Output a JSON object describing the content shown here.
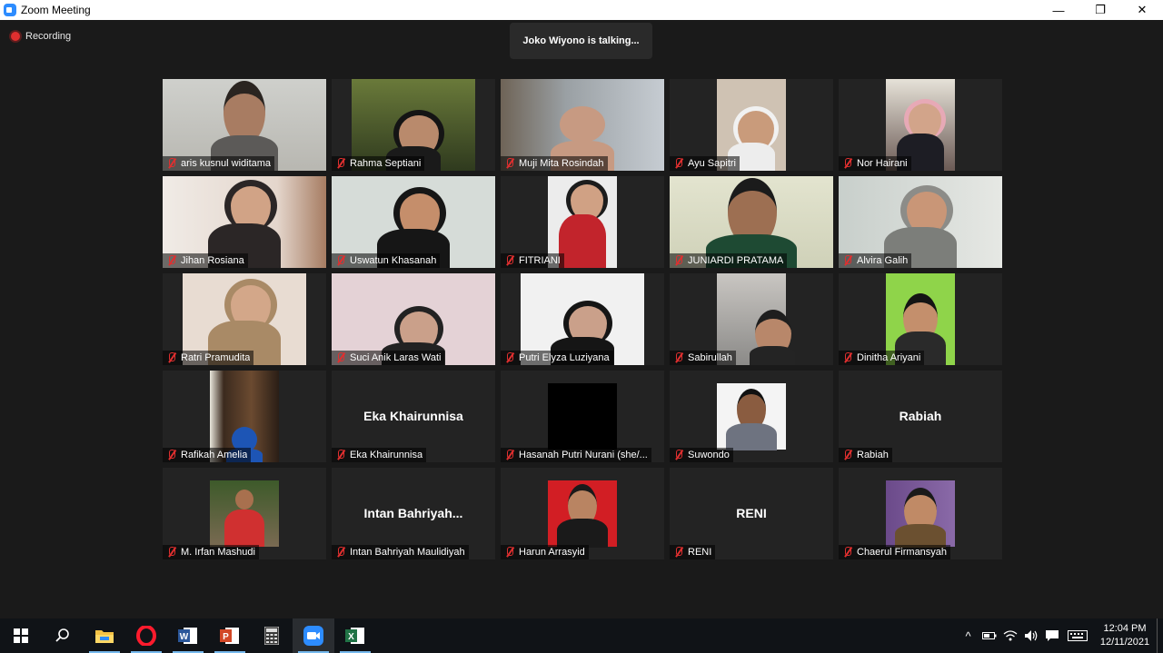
{
  "window": {
    "title": "Zoom Meeting",
    "minimize": "—",
    "maximize": "❐",
    "close": "✕"
  },
  "recording": {
    "label": "Recording"
  },
  "speaker_banner": "Joko Wiyono is talking...",
  "participants": [
    {
      "name": "aris kusnul widitama",
      "muted": true,
      "video": true
    },
    {
      "name": "Rahma Septiani",
      "muted": true,
      "video": true
    },
    {
      "name": "Muji Mita Rosindah",
      "muted": true,
      "video": true
    },
    {
      "name": "Ayu Sapitri",
      "muted": true,
      "video": true
    },
    {
      "name": "Nor Hairani",
      "muted": true,
      "video": true
    },
    {
      "name": "Jihan Rosiana",
      "muted": true,
      "video": true
    },
    {
      "name": "Uswatun Khasanah",
      "muted": true,
      "video": true
    },
    {
      "name": "FITRIANI",
      "muted": true,
      "video": true
    },
    {
      "name": "JUNIARDI PRATAMA",
      "muted": true,
      "video": true
    },
    {
      "name": "Alvira Galih",
      "muted": true,
      "video": true
    },
    {
      "name": "Ratri Pramudita",
      "muted": true,
      "video": true
    },
    {
      "name": "Suci Anik Laras Wati",
      "muted": true,
      "video": true
    },
    {
      "name": "Putri Elyza Luziyana",
      "muted": true,
      "video": true
    },
    {
      "name": "Sabirullah",
      "muted": true,
      "video": true
    },
    {
      "name": "Dinitha Ariyani",
      "muted": true,
      "video": true
    },
    {
      "name": "Rafikah Amelia",
      "muted": true,
      "video": true
    },
    {
      "name": "Eka Khairunnisa",
      "muted": true,
      "video": false,
      "display": "Eka Khairunnisa"
    },
    {
      "name": "Hasanah Putri Nurani (she/...",
      "muted": true,
      "video": true
    },
    {
      "name": "Suwondo",
      "muted": true,
      "video": true
    },
    {
      "name": "Rabiah",
      "muted": true,
      "video": false,
      "display": "Rabiah"
    },
    {
      "name": "M. Irfan Mashudi",
      "muted": true,
      "video": true
    },
    {
      "name": "Intan Bahriyah Maulidiyah",
      "muted": true,
      "video": false,
      "display": "Intan  Bahriyah..."
    },
    {
      "name": "Harun Arrasyid",
      "muted": true,
      "video": true
    },
    {
      "name": "RENI",
      "muted": true,
      "video": false,
      "display": "RENI"
    },
    {
      "name": "Chaerul Firmansyah",
      "muted": true,
      "video": true
    }
  ],
  "taskbar": {
    "apps": [
      "windows-start",
      "search",
      "file-explorer",
      "opera",
      "word",
      "powerpoint",
      "calculator",
      "zoom",
      "excel"
    ],
    "tray": {
      "chevron": "^",
      "time": "12:04 PM",
      "date": "12/11/2021"
    }
  },
  "colors": {
    "muted_mic": "#e02f2f",
    "taskbar": "#101317",
    "meeting_bg": "#1a1a1a",
    "accent": "#2d8cff"
  }
}
